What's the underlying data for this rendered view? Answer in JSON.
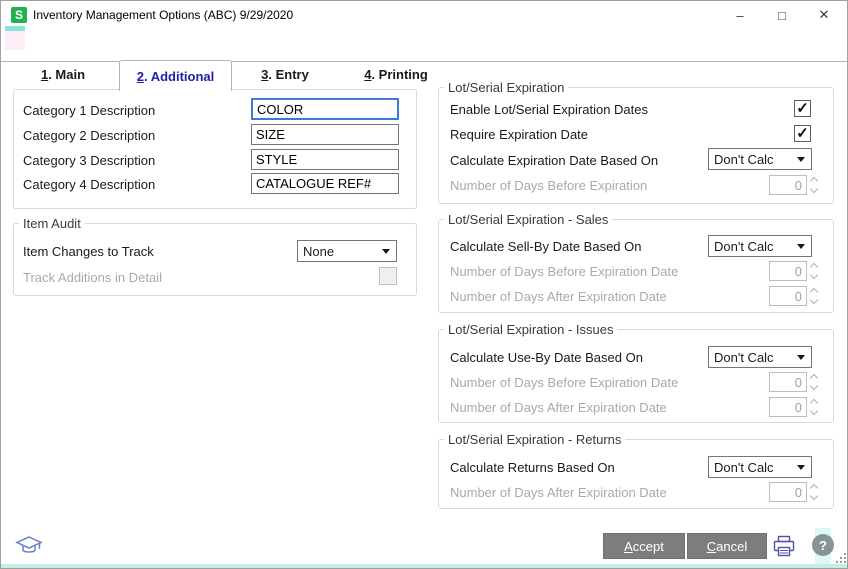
{
  "window": {
    "title": "Inventory Management Options (ABC) 9/29/2020",
    "logo_letter": "S"
  },
  "glyphs": {
    "minimize": "–",
    "maximize": "□",
    "close": "✕",
    "check": "✓",
    "help": "?"
  },
  "tabs": [
    {
      "num": "1",
      "rest": ". Main"
    },
    {
      "num": "2",
      "rest": ". Additional"
    },
    {
      "num": "3",
      "rest": ". Entry"
    },
    {
      "num": "4",
      "rest": ". Printing"
    }
  ],
  "categories": {
    "rows": [
      {
        "label": "Category 1 Description",
        "value": "COLOR"
      },
      {
        "label": "Category 2 Description",
        "value": "SIZE"
      },
      {
        "label": "Category 3 Description",
        "value": "STYLE"
      },
      {
        "label": "Category 4 Description",
        "value": "CATALOGUE REF#"
      }
    ]
  },
  "item_audit": {
    "title": "Item Audit",
    "changes_label": "Item Changes to Track",
    "changes_value": "None",
    "detail_label": "Track Additions in Detail",
    "detail_checked": false
  },
  "expiration": {
    "title": "Lot/Serial Expiration",
    "enable_label": "Enable Lot/Serial Expiration Dates",
    "enable_checked": true,
    "require_label": "Require Expiration Date",
    "require_checked": true,
    "calc_label": "Calculate Expiration Date Based On",
    "calc_value": "Don't Calc",
    "before_label": "Number of Days Before Expiration",
    "before_value": "0"
  },
  "sales": {
    "title": "Lot/Serial Expiration - Sales",
    "calc_label": "Calculate Sell-By Date Based On",
    "calc_value": "Don't Calc",
    "before_label": "Number of Days Before Expiration Date",
    "before_value": "0",
    "after_label": "Number of Days After Expiration Date",
    "after_value": "0"
  },
  "issues": {
    "title": "Lot/Serial Expiration - Issues",
    "calc_label": "Calculate Use-By Date Based On",
    "calc_value": "Don't Calc",
    "before_label": "Number of Days Before Expiration Date",
    "before_value": "0",
    "after_label": "Number of Days After Expiration Date",
    "after_value": "0"
  },
  "returns": {
    "title": "Lot/Serial Expiration - Returns",
    "calc_label": "Calculate Returns Based On",
    "calc_value": "Don't Calc",
    "after_label": "Number of Days After Expiration Date",
    "after_value": "0"
  },
  "footer": {
    "accept_first": "A",
    "accept_rest": "ccept",
    "cancel_first": "C",
    "cancel_rest": "ancel"
  },
  "colors": {
    "logo_green": "#1fb24d",
    "active_tab_text": "#2020a8",
    "focused_field_border": "#3a7bd5",
    "button_gray": "#7d7d7d",
    "teal_accent": "#c6ecea"
  }
}
